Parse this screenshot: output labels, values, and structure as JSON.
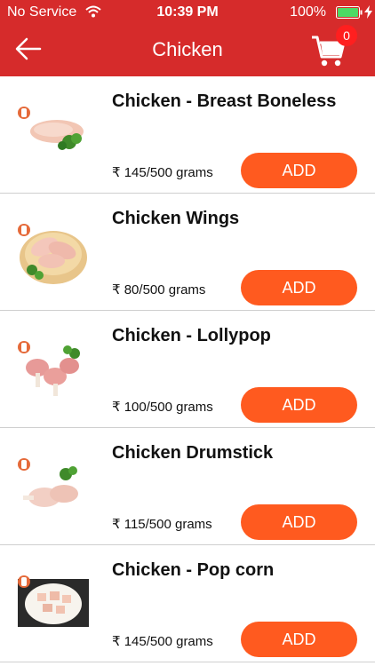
{
  "status_bar": {
    "carrier": "No Service",
    "time": "10:39 PM",
    "battery": "100%"
  },
  "header": {
    "title": "Chicken",
    "cart_count": "0"
  },
  "products": [
    {
      "name": "Chicken - Breast Boneless",
      "price": "₹ 145/500 grams",
      "add_label": "ADD",
      "image_icon": "chicken-breast-image"
    },
    {
      "name": "Chicken Wings",
      "price": "₹ 80/500 grams",
      "add_label": "ADD",
      "image_icon": "chicken-wings-image"
    },
    {
      "name": "Chicken - Lollypop",
      "price": "₹ 100/500 grams",
      "add_label": "ADD",
      "image_icon": "chicken-lollypop-image"
    },
    {
      "name": "Chicken Drumstick",
      "price": "₹ 115/500 grams",
      "add_label": "ADD",
      "image_icon": "chicken-drumstick-image"
    },
    {
      "name": "Chicken - Pop corn",
      "price": "₹ 145/500 grams",
      "add_label": "ADD",
      "image_icon": "chicken-popcorn-image"
    }
  ],
  "colors": {
    "header": "#d62b2b",
    "add_button": "#ff5a1f",
    "badge": "#ff1f1f",
    "battery": "#4cd964"
  }
}
